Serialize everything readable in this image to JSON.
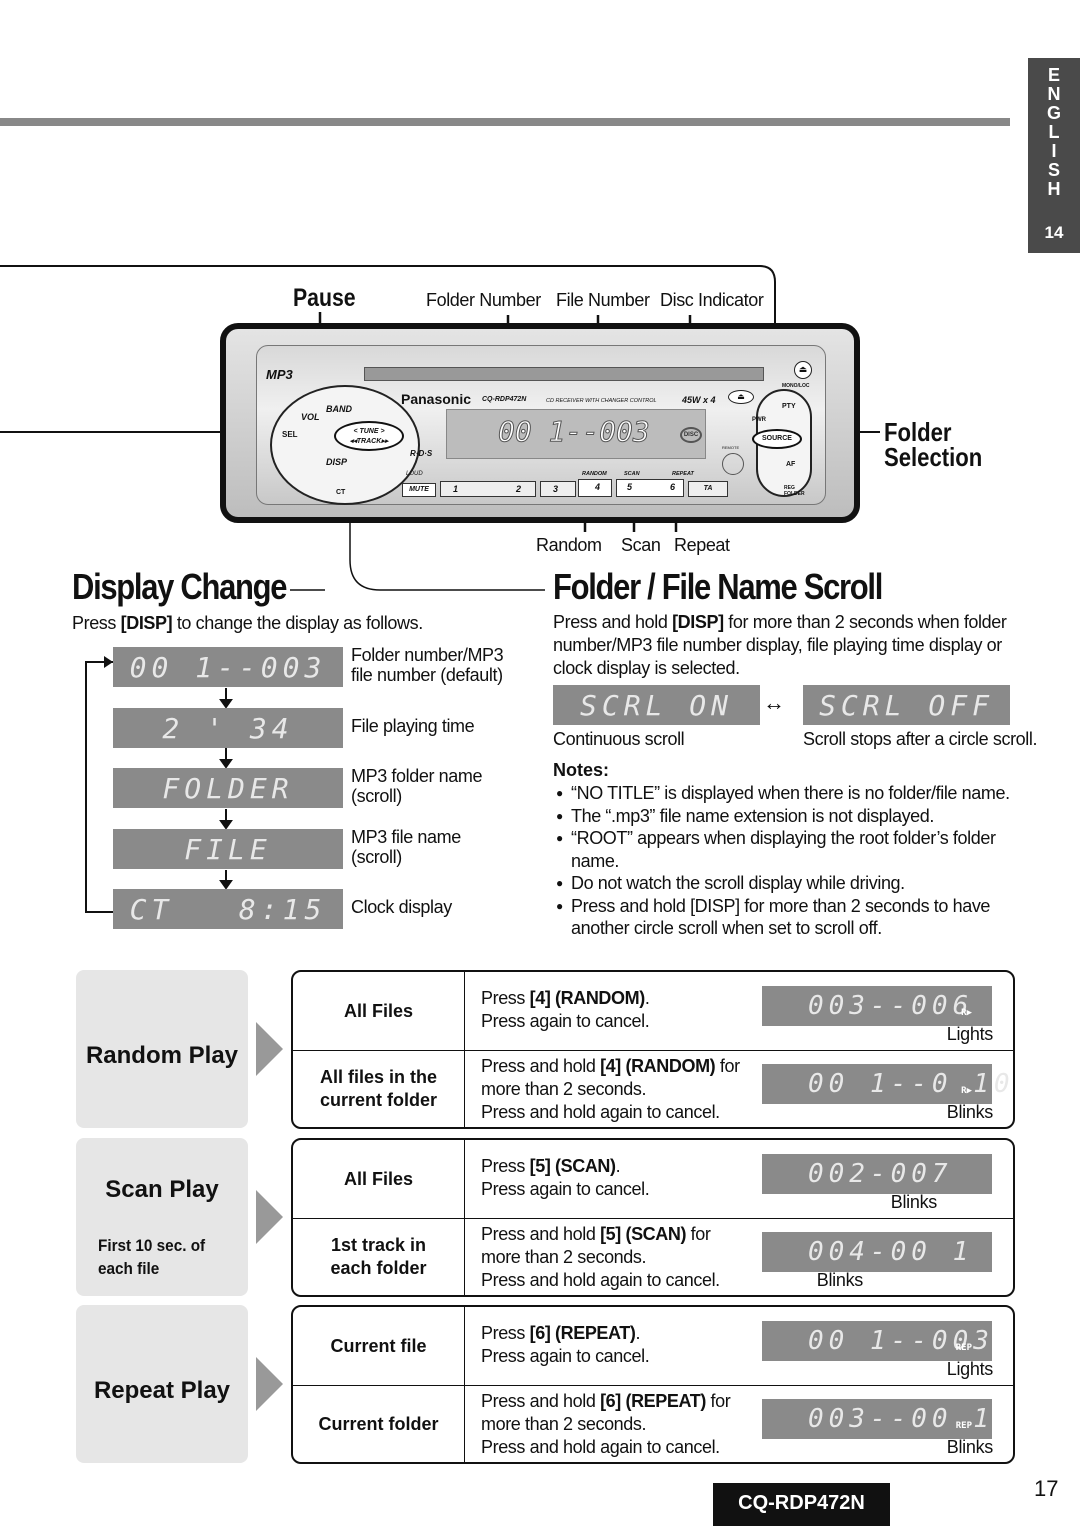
{
  "side_tab": {
    "letters": [
      "E",
      "N",
      "G",
      "L",
      "I",
      "S",
      "H"
    ],
    "page": "14"
  },
  "device": {
    "labels": {
      "pause": "Pause",
      "folder_number": "Folder Number",
      "file_number": "File Number",
      "disc_indicator": "Disc Indicator",
      "folder_selection_1": "Folder",
      "folder_selection_2": "Selection",
      "random": "Random",
      "scan": "Scan",
      "repeat": "Repeat"
    },
    "brand": "Panasonic",
    "model": "CQ-RDP472N",
    "subtitle": "CD RECEIVER WITH CHANGER CONTROL",
    "power": "45W x 4",
    "lcd": "00 1--003",
    "mp3_logo": "MP3",
    "buttons": {
      "band": "BAND",
      "vol": "VOL",
      "sel": "SEL",
      "tune": "< TUNE >",
      "track": "◂◂TRACK▸▸",
      "disp": "DISP",
      "ct": "CT",
      "loud": "LOUD",
      "mute": "MUTE",
      "p1": "1",
      "p2": "2",
      "p3": "3",
      "p4": "4",
      "p5": "5",
      "p6": "6",
      "ta": "TA",
      "random": "RANDOM",
      "scan": "SCAN",
      "repeat": "REPEAT",
      "pty": "PTY",
      "pwr": "PWR",
      "source": "SOURCE",
      "af": "AF",
      "mono_loc": "MONO/LOC",
      "reg_folder": "REG FOLDER",
      "remote": "REMOTE",
      "rds": "R·D·S",
      "disc": "DISC"
    }
  },
  "display_change": {
    "title": "Display Change",
    "intro": {
      "pre": "Press ",
      "key": "[DISP]",
      "post": " to change the display as follows."
    },
    "items": [
      {
        "lcd": "00 1--003",
        "desc1": "Folder number/MP3",
        "desc2": "file number (default)"
      },
      {
        "lcd": "2 ' 34",
        "desc1": "File playing time",
        "desc2": ""
      },
      {
        "lcd": "FOLDER",
        "desc1": "MP3 folder name",
        "desc2": "(scroll)"
      },
      {
        "lcd": "FILE",
        "desc1": "MP3 file name",
        "desc2": "(scroll)"
      },
      {
        "lcd": "CT   8:15",
        "desc1": "Clock display",
        "desc2": ""
      }
    ]
  },
  "scroll": {
    "title": "Folder / File Name Scroll",
    "intro": {
      "pre": "Press and hold ",
      "key": "[DISP]",
      "post": " for more than 2 seconds when folder",
      "line2": "number/MP3 file number display, file playing time display or",
      "line3": "clock display is selected."
    },
    "on_lcd": "SCRL ON",
    "off_lcd": "SCRL OFF",
    "on_caption": "Continuous scroll",
    "off_caption": "Scroll stops after a circle scroll.",
    "notes_title": "Notes:",
    "notes": [
      [
        "“NO TITLE” is displayed when there is no folder/file name."
      ],
      [
        "The “.mp3” file name extension is not displayed."
      ],
      [
        "“ROOT” appears when displaying the root folder’s folder",
        "name."
      ],
      [
        "Do not watch the scroll display while driving."
      ],
      [
        "Press and hold [DISP] for more than 2 seconds to have",
        "another circle scroll when set to scroll off."
      ]
    ]
  },
  "play_sections": [
    {
      "title": "Random Play",
      "subtitle": [],
      "rows": [
        {
          "mode": [
            "All Files"
          ],
          "lines": [
            [
              [
                "Press ",
                0
              ],
              [
                "[4] (RANDOM)",
                1
              ],
              [
                ".",
                0
              ]
            ],
            [
              [
                "Press again to cancel.",
                0
              ]
            ]
          ],
          "lcd": "003--006",
          "indicator": "R▶",
          "status": "Lights"
        },
        {
          "mode": [
            "All files in the",
            "current folder"
          ],
          "lines": [
            [
              [
                "Press and hold ",
                0
              ],
              [
                "[4] (RANDOM)",
                1
              ],
              [
                " for",
                0
              ]
            ],
            [
              [
                "more than 2 seconds.",
                0
              ]
            ],
            [
              [
                "Press and hold again to cancel.",
                0
              ]
            ]
          ],
          "lcd": "00 1--0 10",
          "indicator": "R▶",
          "status": "Blinks"
        }
      ]
    },
    {
      "title": "Scan Play",
      "subtitle": [
        "First 10 sec. of",
        "each file"
      ],
      "rows": [
        {
          "mode": [
            "All Files"
          ],
          "lines": [
            [
              [
                "Press ",
                0
              ],
              [
                "[5] (SCAN)",
                1
              ],
              [
                ".",
                0
              ]
            ],
            [
              [
                "Press again to cancel.",
                0
              ]
            ]
          ],
          "lcd": "002-007",
          "indicator": "",
          "status": "Blinks"
        },
        {
          "mode": [
            "1st track in",
            "each folder"
          ],
          "lines": [
            [
              [
                "Press and hold ",
                0
              ],
              [
                "[5] (SCAN)",
                1
              ],
              [
                " for",
                0
              ]
            ],
            [
              [
                "more than 2 seconds.",
                0
              ]
            ],
            [
              [
                "Press and hold again to cancel.",
                0
              ]
            ]
          ],
          "lcd": "004-00 1",
          "indicator": "",
          "status": "Blinks"
        }
      ]
    },
    {
      "title": "Repeat Play",
      "subtitle": [],
      "rows": [
        {
          "mode": [
            "Current file"
          ],
          "lines": [
            [
              [
                "Press ",
                0
              ],
              [
                "[6] (REPEAT)",
                1
              ],
              [
                ".",
                0
              ]
            ],
            [
              [
                "Press again to cancel.",
                0
              ]
            ]
          ],
          "lcd": "00 1--003",
          "indicator": "REP",
          "status": "Lights"
        },
        {
          "mode": [
            "Current folder"
          ],
          "lines": [
            [
              [
                "Press and hold ",
                0
              ],
              [
                "[6] (REPEAT)",
                1
              ],
              [
                " for",
                0
              ]
            ],
            [
              [
                "more than 2 seconds.",
                0
              ]
            ],
            [
              [
                "Press and hold again to cancel.",
                0
              ]
            ]
          ],
          "lcd": "003--00 1",
          "indicator": "REP",
          "status": "Blinks"
        }
      ]
    }
  ],
  "footer": {
    "page": "17",
    "model": "CQ-RDP472N"
  }
}
